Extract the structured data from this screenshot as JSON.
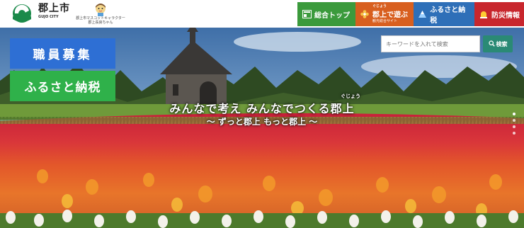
{
  "header": {
    "city_name": "郡上市",
    "city_name_en": "GUJO CITY",
    "mascot_caption_1": "郡上市マスコットキャラクター",
    "mascot_caption_2": "郡上長良ちゃん"
  },
  "nav": {
    "items": [
      {
        "label": "総合トップ",
        "color": "#3b9a3c",
        "icon": "home-page-icon"
      },
      {
        "ruby": "ぐじょう",
        "label": "郡上で遊ぶ",
        "sub": "観光総合サイト",
        "color": "#d85f1f",
        "icon": "flower-icon"
      },
      {
        "label": "ふるさと納税",
        "color": "#2e6fb8",
        "icon": "mountain-icon"
      },
      {
        "label": "防災情報",
        "color": "#c8262d",
        "icon": "alert-lamp-icon"
      }
    ]
  },
  "hero": {
    "cta_recruit": "職員募集",
    "cta_furusato": "ふるさと納税",
    "search_placeholder": "キーワードを入れて検索",
    "search_button": "検索",
    "catch_ruby": "ぐじょう",
    "catch_main": "みんなで考え みんなでつくる郡上",
    "catch_sub": "～ ずっと郡上 もっと郡上 ～",
    "slide_dots": 4,
    "active_dot": 1
  },
  "colors": {
    "recruit": "#2e6fd4",
    "furusato_cta": "#2fb14a",
    "search_button": "#2a8a75"
  }
}
